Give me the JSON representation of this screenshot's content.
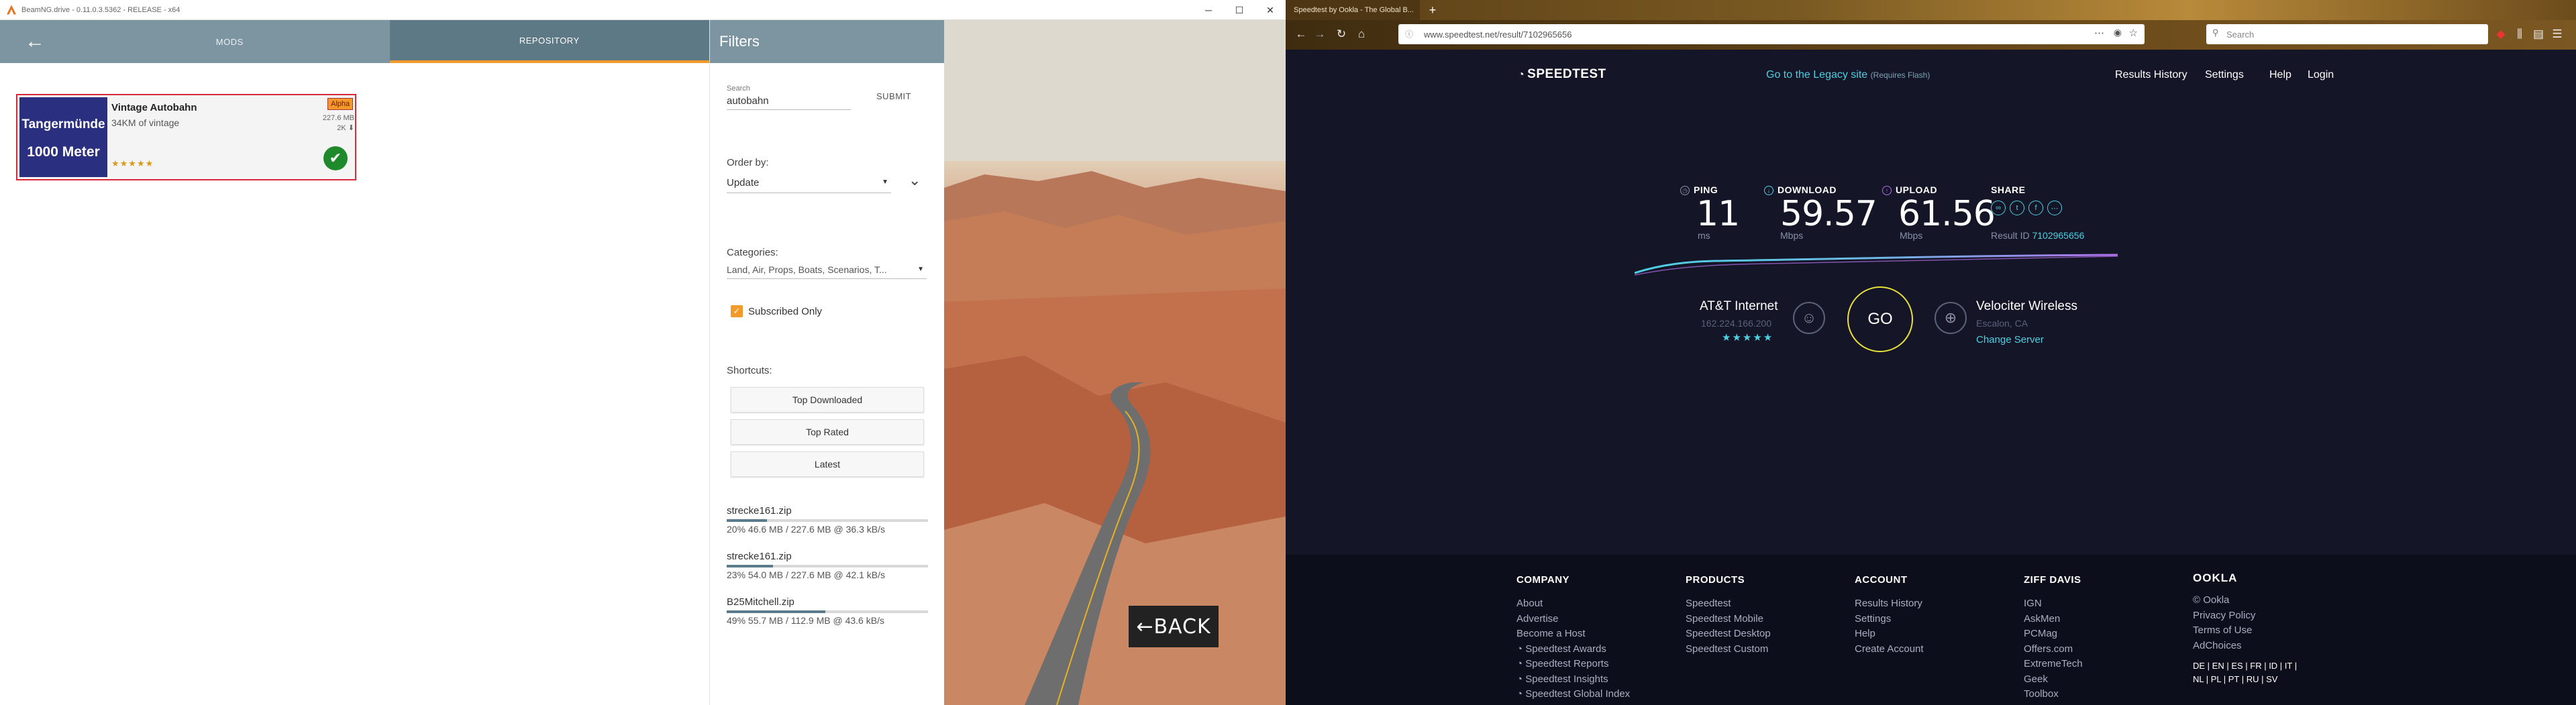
{
  "beamng": {
    "window_title": "BeamNG.drive - 0.11.0.3.5362 - RELEASE - x64",
    "tabs": {
      "mods": "MODS",
      "repository": "REPOSITORY"
    },
    "back_arrow": "←",
    "back_button": "←BACK",
    "mod_card": {
      "thumb_line1": "Tangermünde",
      "thumb_line2": "1000 Meter",
      "title": "Vintage Autobahn",
      "subtitle": "34KM of vintage",
      "badge": "Alpha",
      "size": "227.6 MB",
      "downloads": "2K ⬇",
      "rating_stars": 5,
      "stars": "★★★★★",
      "check": "✔"
    },
    "filters": {
      "title": "Filters",
      "search_label": "Search",
      "search_value": "autobahn",
      "submit": "SUBMIT",
      "order_label": "Order by:",
      "order_value": "Update",
      "sort_arrow": "⌄",
      "categories_label": "Categories:",
      "categories_value": "Land, Air, Props, Boats, Scenarios, T...",
      "subscribed_label": "Subscribed Only",
      "shortcuts_label": "Shortcuts:",
      "shortcut_top_downloaded": "Top Downloaded",
      "shortcut_top_rated": "Top Rated",
      "shortcut_latest": "Latest"
    },
    "downloads": [
      {
        "name": "strecke161.zip",
        "percent": 20,
        "stat": "20% 46.6 MB / 227.6 MB @ 36.3 kB/s"
      },
      {
        "name": "strecke161.zip",
        "percent": 23,
        "stat": "23% 54.0 MB / 227.6 MB @ 42.1 kB/s"
      },
      {
        "name": "B25Mitchell.zip",
        "percent": 49,
        "stat": "49% 55.7 MB / 112.9 MB @ 43.6 kB/s"
      }
    ]
  },
  "firefox": {
    "tab_title": "Speedtest by Ookla - The Global B...",
    "url": "www.speedtest.net/result/7102965656",
    "search_placeholder": "Search"
  },
  "speedtest": {
    "logo": "SPEEDTEST",
    "legacy_link": "Go to the Legacy site",
    "legacy_note": "(Requires Flash)",
    "nav": {
      "results_history": "Results History",
      "settings": "Settings",
      "help": "Help",
      "login": "Login"
    },
    "ping": {
      "label": "PING",
      "value": "11",
      "unit": "ms"
    },
    "download": {
      "label": "DOWNLOAD",
      "value": "59.57",
      "unit": "Mbps"
    },
    "upload": {
      "label": "UPLOAD",
      "value": "61.56",
      "unit": "Mbps"
    },
    "share_label": "SHARE",
    "result_id_label": "Result ID",
    "result_id": "7102965656",
    "isp": {
      "name": "AT&T Internet",
      "ip": "162.224.166.200",
      "stars": "★★★★★"
    },
    "go": "GO",
    "server": {
      "name": "Velociter Wireless",
      "location": "Escalon, CA",
      "change": "Change Server"
    },
    "footer": {
      "company": {
        "heading": "COMPANY",
        "links": [
          "About",
          "Advertise",
          "Become a Host",
          "Speedtest Awards",
          "Speedtest Reports",
          "Speedtest Insights",
          "Speedtest Global Index"
        ]
      },
      "products": {
        "heading": "PRODUCTS",
        "links": [
          "Speedtest",
          "Speedtest Mobile",
          "Speedtest Desktop",
          "Speedtest Custom"
        ]
      },
      "account": {
        "heading": "ACCOUNT",
        "links": [
          "Results History",
          "Settings",
          "Help",
          "Create Account"
        ]
      },
      "ziff": {
        "heading": "ZIFF DAVIS",
        "links": [
          "IGN",
          "AskMen",
          "PCMag",
          "Offers.com",
          "ExtremeTech",
          "Geek",
          "Toolbox"
        ]
      },
      "ookla": {
        "logo": "OOKLA",
        "links": [
          "© Ookla",
          "Privacy Policy",
          "Terms of Use",
          "AdChoices"
        ],
        "langs1": "DE | EN | ES | FR | ID | IT |",
        "langs2": "NL | PL | PT | RU | SV"
      }
    }
  },
  "colors": {
    "beam_header": "#7d95a0",
    "beam_accent": "#f49a2a",
    "card_border": "#d9283a",
    "speedtest_bg": "#141526",
    "speedtest_cyan": "#4dd0e1",
    "go_ring": "#e8e23a"
  }
}
